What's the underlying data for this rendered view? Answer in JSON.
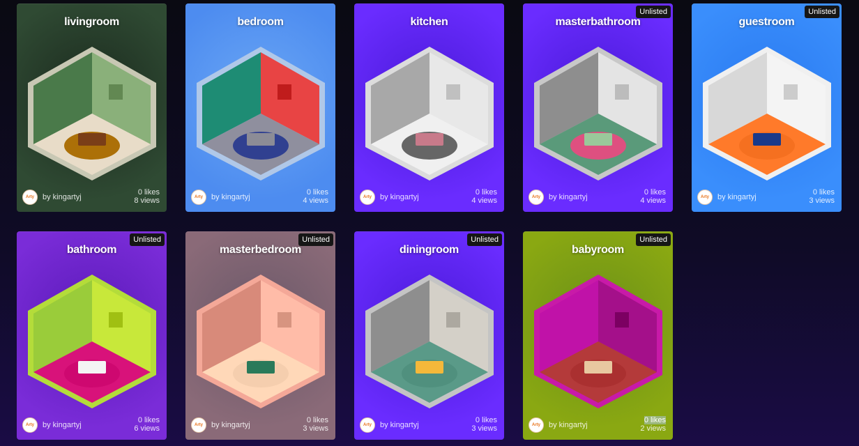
{
  "cards": [
    {
      "title": "livingroom",
      "badge": "",
      "author": "by kingartyj",
      "likes": "0 likes",
      "views": "8 views",
      "bg": "#2f4a33",
      "bg2": "#1b2a1e",
      "wall_left": "#4a7a4a",
      "wall_right": "#8ab07a",
      "floor": "#e8dcc8",
      "frame": "#c8c8b4",
      "rug": "#b67a12",
      "item": "#7a3e18",
      "avatar_text": "Arty"
    },
    {
      "title": "bedroom",
      "badge": "",
      "author": "by kingartyj",
      "likes": "0 likes",
      "views": "4 views",
      "bg": "#4d8cf0",
      "bg2": "#6aa6f4",
      "wall_left": "#1e8c74",
      "wall_right": "#e84444",
      "floor": "#8f8f9e",
      "frame": "#b0c8e8",
      "rug": "#3a4a9a",
      "item": "#8c8c96",
      "avatar_text": "Arty"
    },
    {
      "title": "kitchen",
      "badge": "",
      "author": "by kingartyj",
      "likes": "0 likes",
      "views": "4 views",
      "bg": "#6a2cff",
      "bg2": "#4a1ad8",
      "wall_left": "#a8a8a8",
      "wall_right": "#e8e8e8",
      "floor": "#f0f0f0",
      "frame": "#dcdcdc",
      "rug": "#707070",
      "item": "#c87a8a",
      "avatar_text": "Arty"
    },
    {
      "title": "masterbathroom",
      "badge": "Unlisted",
      "author": "by kingartyj",
      "likes": "0 likes",
      "views": "4 views",
      "bg": "#6a2cff",
      "bg2": "#4a1ad8",
      "wall_left": "#8e8e8e",
      "wall_right": "#e4e4e4",
      "floor": "#5a9a7a",
      "frame": "#c8c8c8",
      "rug": "#e85a8a",
      "item": "#9ac89a",
      "avatar_text": "Arty"
    },
    {
      "title": "guestroom",
      "badge": "Unlisted",
      "author": "by kingartyj",
      "likes": "0 likes",
      "views": "3 views",
      "bg": "#3a8efc",
      "bg2": "#2a7af0",
      "wall_left": "#d8d8d8",
      "wall_right": "#f4f4f4",
      "floor": "#ff7a2a",
      "frame": "#f0f0f0",
      "rug": "#ff7a2a",
      "item": "#1a3a8a",
      "avatar_text": "Arty"
    },
    {
      "title": "bathroom",
      "badge": "Unlisted",
      "author": "by kingartyj",
      "likes": "0 likes",
      "views": "6 views",
      "bg": "#7a2cd8",
      "bg2": "#5a1ab8",
      "wall_left": "#9acc3a",
      "wall_right": "#c8e83a",
      "floor": "#d8127a",
      "frame": "#b4dc3a",
      "rug": "#d8127a",
      "item": "#f4f4f4",
      "avatar_text": "Arty"
    },
    {
      "title": "masterbedroom",
      "badge": "Unlisted",
      "author": "by kingartyj",
      "likes": "0 likes",
      "views": "3 views",
      "bg": "#8a6a78",
      "bg2": "#6a5868",
      "wall_left": "#d88a7a",
      "wall_right": "#ffbca8",
      "floor": "#ffd8b8",
      "frame": "#f4a898",
      "rug": "#ffd8b8",
      "item": "#2a7a5a",
      "avatar_text": "Arty"
    },
    {
      "title": "diningroom",
      "badge": "Unlisted",
      "author": "by kingartyj",
      "likes": "0 likes",
      "views": "3 views",
      "bg": "#6a2cff",
      "bg2": "#4a1ad8",
      "wall_left": "#8e8e8e",
      "wall_right": "#d4d0c8",
      "floor": "#5a9a88",
      "frame": "#c4c4c4",
      "rug": "#5a9a88",
      "item": "#f4b83a",
      "avatar_text": "Arty"
    },
    {
      "title": "babyroom",
      "badge": "Unlisted",
      "author": "by kingartyj",
      "likes": "0 likes",
      "views": "2 views",
      "bg": "#8aa812",
      "bg2": "#6a9018",
      "wall_left": "#c012a8",
      "wall_right": "#a4108a",
      "floor": "#b43a3a",
      "frame": "#c81aa8",
      "rug": "#b43a3a",
      "item": "#e8c8a0",
      "avatar_text": "Arty",
      "likes_highlighted": true
    }
  ]
}
